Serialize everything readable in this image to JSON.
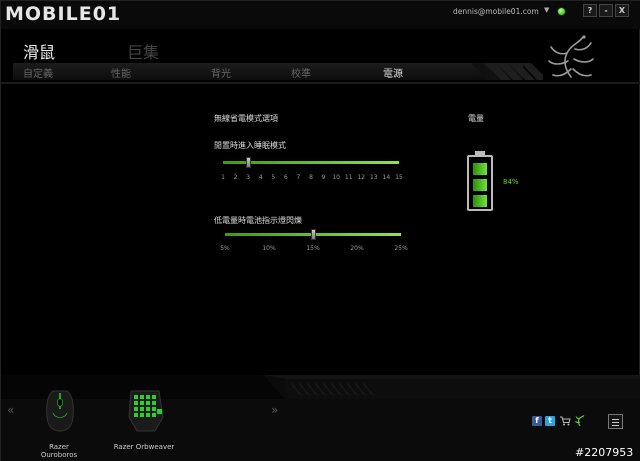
{
  "app": {
    "logo_text": "MOBILE01",
    "user_email": "dennis@mobile01.com",
    "caret": "▼",
    "window_buttons": {
      "help": "?",
      "minimize": "-",
      "close": "X"
    }
  },
  "header": {
    "main_tabs": [
      {
        "label": "滑鼠",
        "active": true
      },
      {
        "label": "巨集",
        "active": false
      }
    ],
    "sub_tabs": [
      {
        "label": "自定義",
        "active": false
      },
      {
        "label": "性能",
        "active": false
      },
      {
        "label": "背光",
        "active": false
      },
      {
        "label": "校準",
        "active": false
      },
      {
        "label": "電源",
        "active": true
      }
    ]
  },
  "power": {
    "section_title": "無線省電模式選項",
    "sleep": {
      "label": "閒置時進入睡眠模式",
      "ticks": [
        "1",
        "2",
        "3",
        "4",
        "5",
        "6",
        "7",
        "8",
        "9",
        "10",
        "11",
        "12",
        "13",
        "14",
        "15"
      ],
      "value": 3,
      "min": 1,
      "max": 15
    },
    "low_battery": {
      "label": "低電量時電池指示燈閃爍",
      "ticks": [
        "5%",
        "10%",
        "15%",
        "20%",
        "25%"
      ],
      "value": 15,
      "min": 5,
      "max": 25
    },
    "battery_label": "電量",
    "battery_percent": "84%",
    "battery_level": 0.84
  },
  "devices": [
    {
      "name": "Razer Ouroboros"
    },
    {
      "name": "Razer Orbweaver"
    }
  ],
  "nav_arrows": {
    "prev": "«",
    "next": "»"
  },
  "social": {
    "facebook": "f",
    "twitter": "t"
  },
  "watermark": "#2207953",
  "colors": {
    "accent_green": "#6cd932",
    "background": "#000000"
  }
}
